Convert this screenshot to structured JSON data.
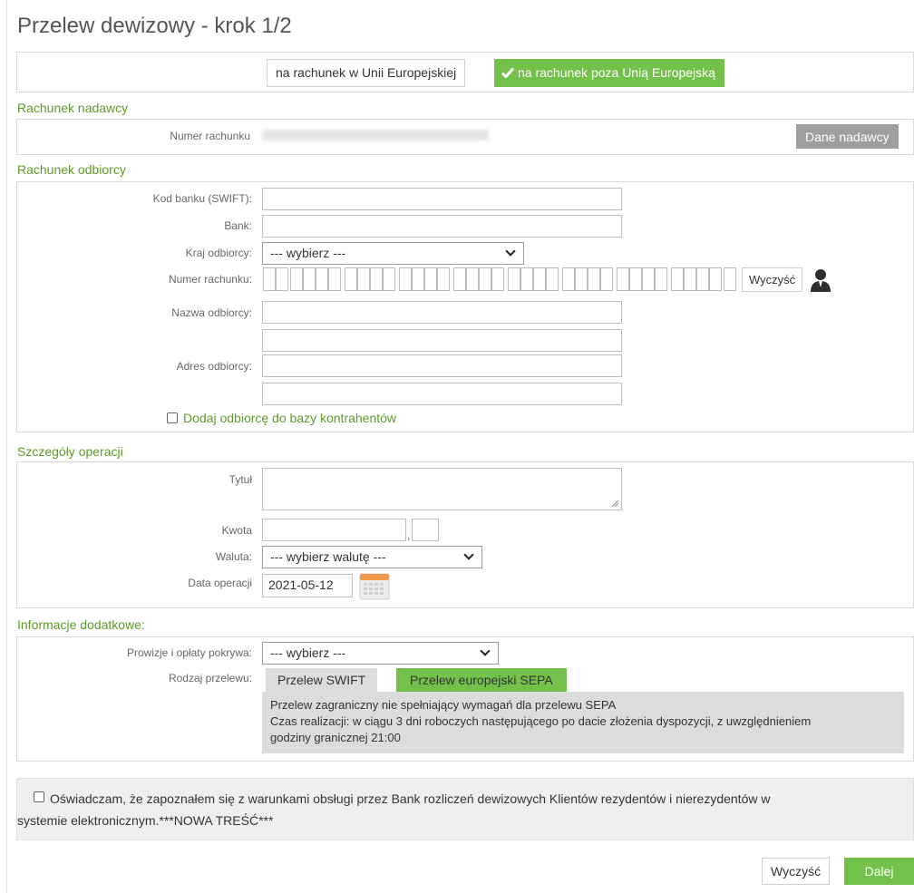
{
  "title": "Przelew dewizowy - krok 1/2",
  "destination": {
    "eu_button": "na rachunek w Unii Europejskiej",
    "non_eu_button": "na rachunek poza Unią Europejską"
  },
  "sender": {
    "section_title": "Rachunek nadawcy",
    "account_label": "Numer rachunku",
    "sender_button": "Dane nadawcy"
  },
  "recipient": {
    "section_title": "Rachunek odbiorcy",
    "swift_label": "Kod banku (SWIFT):",
    "bank_label": "Bank:",
    "country_label": "Kraj odbiorcy:",
    "country_value": "--- wybierz ---",
    "account_label": "Numer rachunku:",
    "clear_button": "Wyczyść",
    "name_label": "Nazwa odbiorcy:",
    "address_label": "Adres odbiorcy:",
    "add_to_db_label": "Dodaj odbiorcę do bazy kontrahentów"
  },
  "details": {
    "section_title": "Szczegóły operacji",
    "title_label": "Tytuł",
    "amount_label": "Kwota",
    "amount_separator": ",",
    "currency_label": "Waluta:",
    "currency_value": "--- wybierz walutę ---",
    "date_label": "Data operacji",
    "date_value": "2021-05-12"
  },
  "additional": {
    "section_title": "Informacje dodatkowe:",
    "fees_label": "Prowizje i opłaty pokrywa:",
    "fees_value": "--- wybierz ---",
    "type_label": "Rodzaj przelewu:",
    "tab_swift": "Przelew SWIFT",
    "tab_sepa": "Przelew europejski SEPA",
    "info_line1": "Przelew zagraniczny nie spełniający wymagań dla przelewu SEPA",
    "info_line2": "Czas realizacji: w ciągu 3 dni roboczych następującego po dacie złożenia dyspozycji, z uwzględnieniem",
    "info_line3": "godziny granicznej 21:00"
  },
  "declaration": {
    "line1": "Oświadczam, że zapoznałem się z warunkami obsługi przez Bank rozliczeń dewizowych Klientów rezydentów i nierezydentów w",
    "line2": "systemie elektronicznym.***NOWA TREŚĆ***"
  },
  "footer": {
    "clear_button": "Wyczyść",
    "next_button": "Dalej"
  },
  "colors": {
    "accent_green": "#73c04a",
    "section_title_green": "#5f9a2b",
    "grey_button": "#9e9e9e"
  }
}
